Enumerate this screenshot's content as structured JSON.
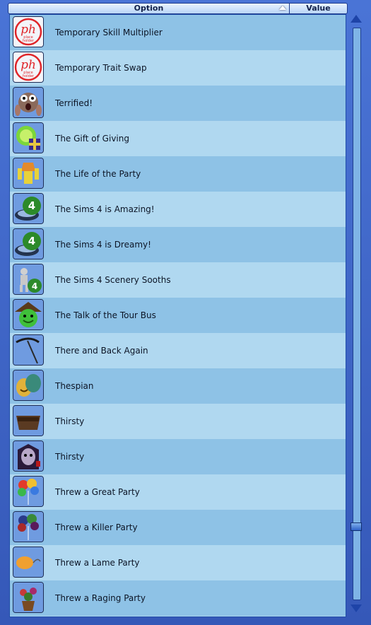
{
  "header": {
    "option_label": "Option",
    "value_label": "Value"
  },
  "rows": [
    {
      "label": "Temporary Skill Multiplier",
      "icon": "placeholder-icon",
      "ph": "ph",
      "ph_sub": "place\nholder"
    },
    {
      "label": "Temporary Trait Swap",
      "icon": "placeholder-icon",
      "ph": "ph",
      "ph_sub": "place\nholder"
    },
    {
      "label": "Terrified!",
      "icon": "terrified-face-icon"
    },
    {
      "label": "The Gift of Giving",
      "icon": "gift-plumbob-icon"
    },
    {
      "label": "The Life of the Party",
      "icon": "lampshade-sim-icon"
    },
    {
      "label": "The Sims 4 is Amazing!",
      "icon": "sims4-logo-icon",
      "badge": "4"
    },
    {
      "label": "The Sims 4 is Dreamy!",
      "icon": "sims4-logo-icon",
      "badge": "4"
    },
    {
      "label": "The Sims 4 Scenery Sooths",
      "icon": "sims4-astronaut-icon",
      "badge": "4"
    },
    {
      "label": "The Talk of the Tour Bus",
      "icon": "house-plumbob-icon"
    },
    {
      "label": "There and Back Again",
      "icon": "scythe-icon"
    },
    {
      "label": "Thespian",
      "icon": "theater-masks-icon"
    },
    {
      "label": "Thirsty",
      "icon": "bathtub-icon"
    },
    {
      "label": "Thirsty",
      "icon": "vampire-icon"
    },
    {
      "label": "Threw a Great Party",
      "icon": "balloons-icon"
    },
    {
      "label": "Threw a Killer Party",
      "icon": "dark-balloons-icon"
    },
    {
      "label": "Threw a Lame Party",
      "icon": "deflated-balloon-icon"
    },
    {
      "label": "Threw a Raging Party",
      "icon": "flower-pot-icon"
    }
  ],
  "colors": {
    "accent": "#3c63c4",
    "row_odd": "#8ec2e6",
    "row_even": "#b0d8f0",
    "placeholder_red": "#e0262a"
  }
}
